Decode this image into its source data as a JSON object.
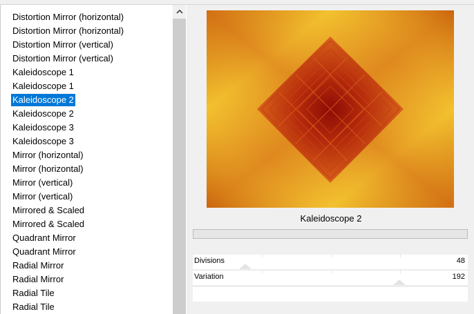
{
  "effects_list": {
    "items": [
      {
        "label": "Distortion Mirror (horizontal)"
      },
      {
        "label": "Distortion Mirror (horizontal)"
      },
      {
        "label": "Distortion Mirror (vertical)"
      },
      {
        "label": "Distortion Mirror (vertical)"
      },
      {
        "label": "Kaleidoscope 1"
      },
      {
        "label": "Kaleidoscope 1"
      },
      {
        "label": "Kaleidoscope 2",
        "selected": true
      },
      {
        "label": "Kaleidoscope 2"
      },
      {
        "label": "Kaleidoscope 3"
      },
      {
        "label": "Kaleidoscope 3"
      },
      {
        "label": "Mirror (horizontal)"
      },
      {
        "label": "Mirror (horizontal)"
      },
      {
        "label": "Mirror (vertical)"
      },
      {
        "label": "Mirror (vertical)"
      },
      {
        "label": "Mirrored & Scaled"
      },
      {
        "label": "Mirrored & Scaled"
      },
      {
        "label": "Quadrant Mirror"
      },
      {
        "label": "Quadrant Mirror"
      },
      {
        "label": "Radial Mirror"
      },
      {
        "label": "Radial Mirror"
      },
      {
        "label": "Radial Tile"
      },
      {
        "label": "Radial Tile"
      }
    ],
    "scroll_up_icon": "chevron-up-icon"
  },
  "preview": {
    "effect_name": "Kaleidoscope 2",
    "colors": {
      "center": "#9c1006",
      "mid": "#e07e18",
      "edge": "#f4c530"
    }
  },
  "params": [
    {
      "label": "Divisions",
      "value": "48",
      "level": 0.19
    },
    {
      "label": "Variation",
      "value": "192",
      "level": 0.75
    }
  ],
  "colors": {
    "selection": "#0078d7",
    "scroll_thumb": "#cdcdcd"
  }
}
